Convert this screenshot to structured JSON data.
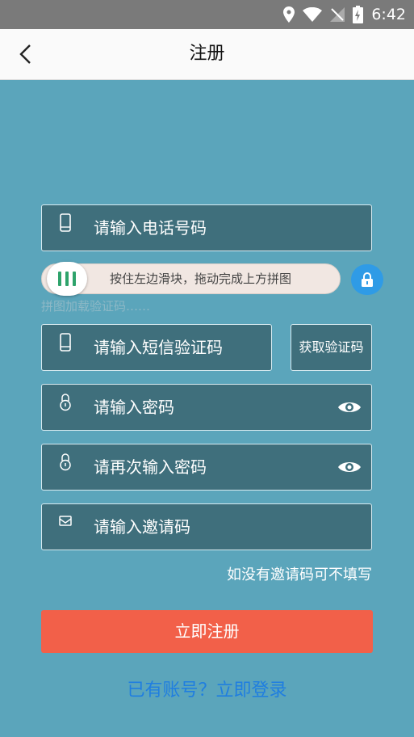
{
  "status_bar": {
    "time": "6:42"
  },
  "app_bar": {
    "title": "注册"
  },
  "form": {
    "phone_placeholder": "请输入电话号码",
    "slider_text": "按住左边滑块，拖动完成上方拼图",
    "faded_hint": "拼图加载验证码……",
    "sms_placeholder": "请输入短信验证码",
    "get_code_label": "获取验证码",
    "password_placeholder": "请输入密码",
    "password_confirm_placeholder": "请再次输入密码",
    "invite_placeholder": "请输入邀请码",
    "invite_note": "如没有邀请码可不填写",
    "submit_label": "立即注册",
    "login_link": "已有账号？立即登录"
  },
  "colors": {
    "background": "#5ba5bb",
    "field": "#3f6f7c",
    "submit": "#f26049",
    "link": "#1f7ee0",
    "slider_accent": "#2ea36b",
    "lock_button": "#2f9be6"
  },
  "icons": {
    "status": [
      "location-icon",
      "wifi-icon",
      "no-sim-icon",
      "battery-charging-icon"
    ],
    "back": "back-arrow-icon",
    "phone": "phone-icon",
    "lock": "padlock-icon",
    "eye": "eye-icon",
    "invite": "envelope-icon"
  }
}
